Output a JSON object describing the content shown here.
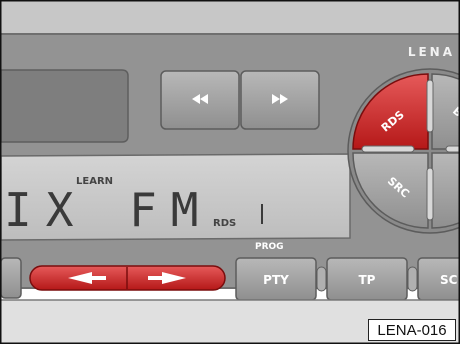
{
  "brand": "LENA",
  "display": {
    "station": "IX FM",
    "learn_label": "LEARN",
    "rds_indicator": "RDS"
  },
  "buttons": {
    "rewind_icon": "double-left-arrow-icon",
    "forward_icon": "double-right-arrow-icon",
    "rds": "RDS",
    "src": "SRC",
    "pty": "PTY",
    "tp": "TP",
    "sc": "SC",
    "prog_label": "PROG",
    "seek_left_icon": "left-arrow-icon",
    "seek_right_icon": "right-arrow-icon"
  },
  "figure_label": "LENA-016",
  "colors": {
    "panel": "#939393",
    "panel_dark": "#7d7d7d",
    "button": "#a9a9a9",
    "rds_red": "#d42a2a",
    "seek_red": "#c81e1e",
    "display": "#c9c9c9",
    "lcd_text": "#3a3a3a"
  }
}
